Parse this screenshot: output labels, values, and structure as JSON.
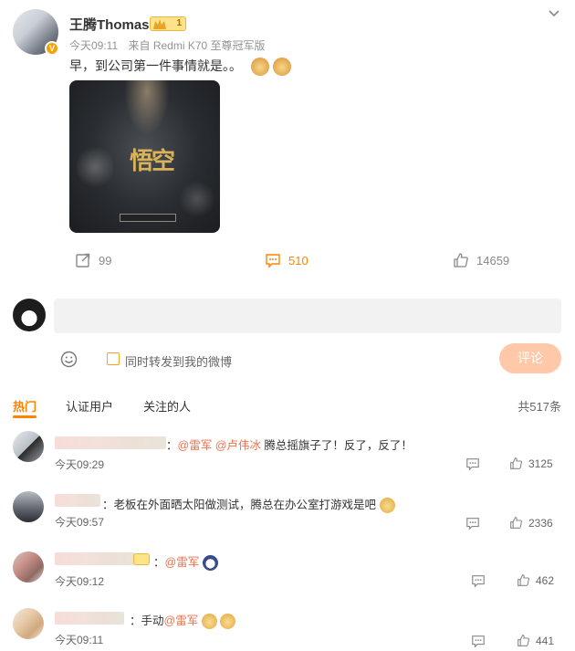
{
  "post": {
    "author": "王腾Thomas",
    "time": "今天09:11",
    "source": "来自 Redmi K70 至尊冠军版",
    "text": "早，到公司第一件事情就是。。",
    "image_caption": "悟空",
    "actions": {
      "repost_count": "99",
      "comment_count": "510",
      "like_count": "14659"
    }
  },
  "composer": {
    "placeholder": "",
    "forward_label": "同时转发到我的微博",
    "submit_label": "评论"
  },
  "tabs": {
    "hot": "热门",
    "verified": "认证用户",
    "following": "关注的人",
    "total": "共517条"
  },
  "comments": [
    {
      "sep": "：",
      "mention1": "@雷军",
      "mention2": "@卢伟冰",
      "text": " 腾总摇旗子了！反了，反了！",
      "time": "今天09:29",
      "likes": "3125"
    },
    {
      "sep": "：",
      "text": "老板在外面晒太阳做测试，腾总在办公室打游戏是吧",
      "time": "今天09:57",
      "likes": "2336"
    },
    {
      "sep": "：",
      "mention1": "@雷军",
      "time": "今天09:12",
      "likes": "462"
    },
    {
      "sep": "：",
      "prefix": "手动",
      "mention1": "@雷军",
      "time": "今天09:11",
      "likes": "441"
    }
  ],
  "colors": {
    "accent": "#ff8200",
    "link": "#eb7350",
    "submit_bg": "#ffc8a8"
  }
}
